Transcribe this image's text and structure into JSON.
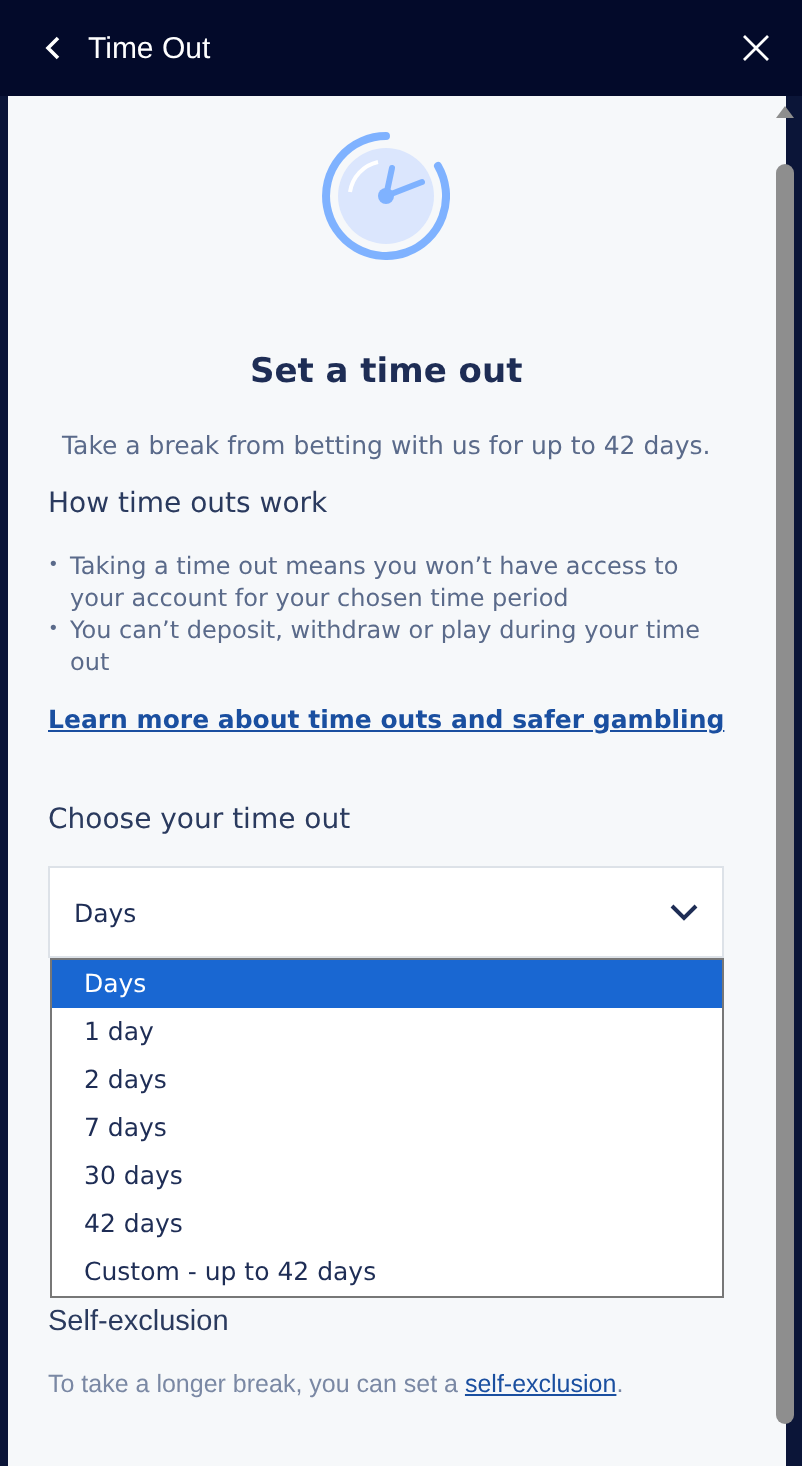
{
  "header": {
    "title": "Time Out"
  },
  "intro": {
    "title": "Set a time out",
    "subtitle": "Take a break from betting with us for up to 42 days."
  },
  "info": {
    "heading": "How time outs work",
    "bullet_marker": "•",
    "bullets": [
      "Taking a time out means you won’t have access to your account for your chosen time period",
      "You can’t deposit, withdraw or play during your time out"
    ],
    "link": "Learn more about time outs and safer gambling"
  },
  "time_out": {
    "label": "Choose your time out",
    "select": {
      "value": "Days",
      "expanded": true
    },
    "options": [
      {
        "label": "Days",
        "selected": true
      },
      {
        "label": "1 day",
        "selected": false
      },
      {
        "label": "2 days",
        "selected": false
      },
      {
        "label": "7 days",
        "selected": false
      },
      {
        "label": "30 days",
        "selected": false
      },
      {
        "label": "42 days",
        "selected": false
      },
      {
        "label": "Custom - up to 42 days",
        "selected": false
      }
    ]
  },
  "self_exclusion": {
    "heading": "Self-exclusion",
    "text": "To take a longer break, you can set a ",
    "link": "self-exclusion",
    "text_end": "."
  }
}
